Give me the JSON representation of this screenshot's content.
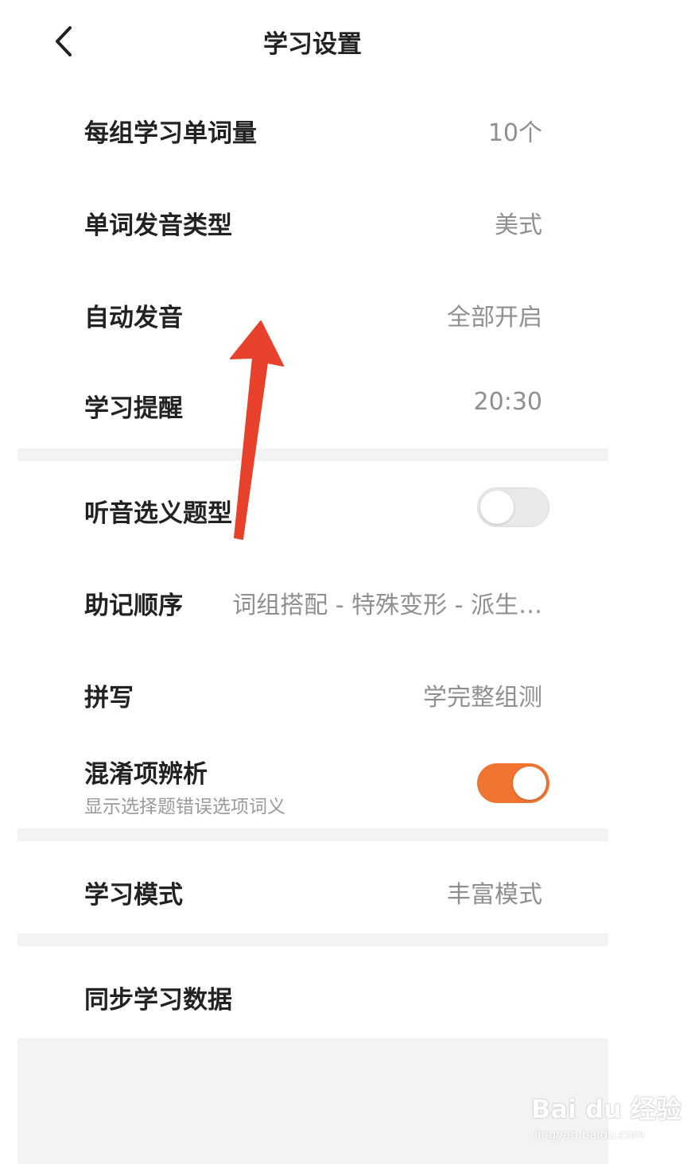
{
  "header": {
    "title": "学习设置",
    "back_icon": "chevron-left-icon"
  },
  "settings": {
    "words_per_group": {
      "label": "每组学习单词量",
      "value": "10个"
    },
    "pronunciation_type": {
      "label": "单词发音类型",
      "value": "美式"
    },
    "auto_pronounce": {
      "label": "自动发音",
      "value": "全部开启"
    },
    "study_reminder": {
      "label": "学习提醒",
      "value": "20:30"
    },
    "listen_choose_meaning": {
      "label": "听音选义题型",
      "toggle": false
    },
    "mnemonic_order": {
      "label": "助记顺序",
      "value": "词组搭配 - 特殊变形 - 派生…"
    },
    "spelling": {
      "label": "拼写",
      "value": "学完整组测"
    },
    "confusing_items": {
      "label": "混淆项辨析",
      "subtitle": "显示选择题错误选项词义",
      "toggle": true
    },
    "study_mode": {
      "label": "学习模式",
      "value": "丰富模式"
    },
    "sync_data": {
      "label": "同步学习数据"
    }
  },
  "watermark": {
    "main": "Bai du 经验",
    "sub": "jingyan.baidu.com"
  },
  "colors": {
    "accent": "#ef7430",
    "annotation_arrow": "#e8412b",
    "section_gap": "#f3f3f3",
    "value_text": "#8f8f8f"
  }
}
